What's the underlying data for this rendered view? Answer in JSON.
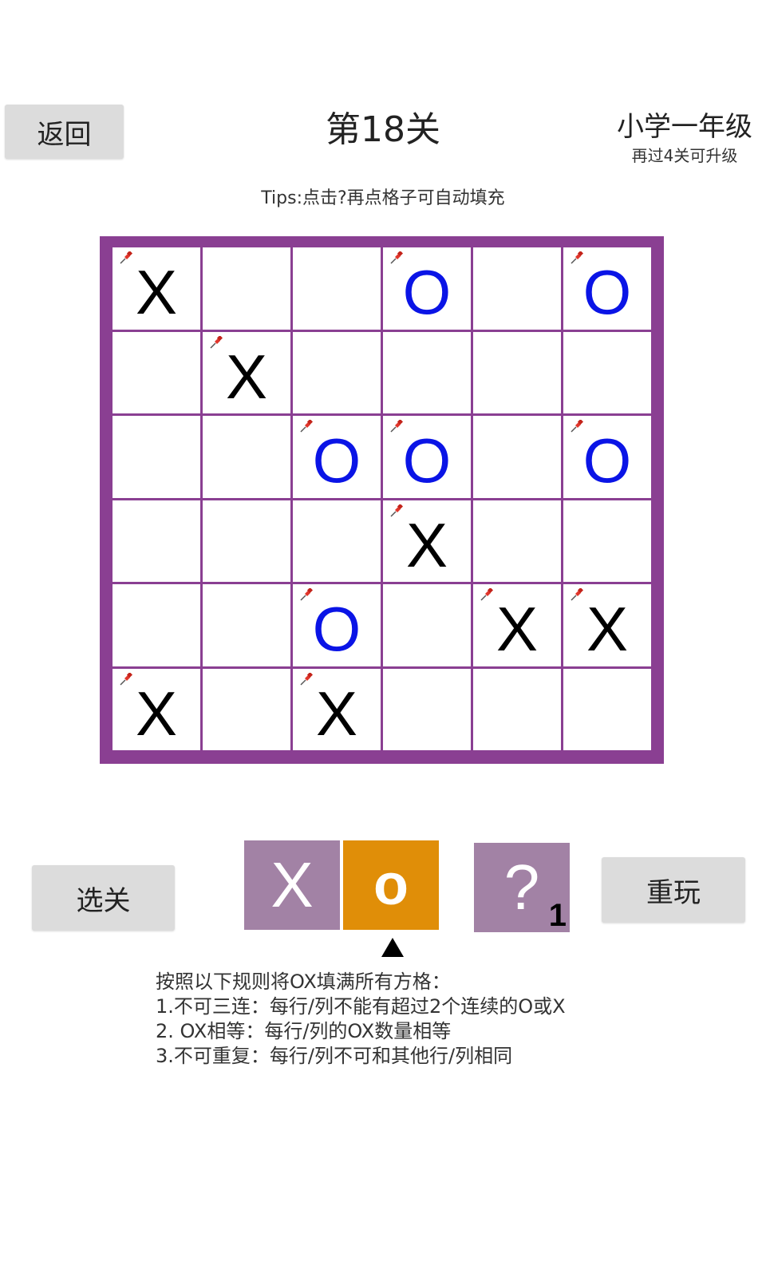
{
  "header": {
    "back_label": "返回",
    "level_title": "第18关",
    "grade": "小学一年级",
    "grade_progress": "再过4关可升级"
  },
  "tips": "Tips:点击?再点格子可自动填充",
  "board": {
    "rows": 6,
    "cols": 6,
    "cells": [
      [
        {
          "v": "X",
          "fixed": true
        },
        {
          "v": "",
          "fixed": false
        },
        {
          "v": "",
          "fixed": false
        },
        {
          "v": "O",
          "fixed": true
        },
        {
          "v": "",
          "fixed": false
        },
        {
          "v": "O",
          "fixed": true
        }
      ],
      [
        {
          "v": "",
          "fixed": false
        },
        {
          "v": "X",
          "fixed": true
        },
        {
          "v": "",
          "fixed": false
        },
        {
          "v": "",
          "fixed": false
        },
        {
          "v": "",
          "fixed": false
        },
        {
          "v": "",
          "fixed": false
        }
      ],
      [
        {
          "v": "",
          "fixed": false
        },
        {
          "v": "",
          "fixed": false
        },
        {
          "v": "O",
          "fixed": true
        },
        {
          "v": "O",
          "fixed": true
        },
        {
          "v": "",
          "fixed": false
        },
        {
          "v": "O",
          "fixed": true
        }
      ],
      [
        {
          "v": "",
          "fixed": false
        },
        {
          "v": "",
          "fixed": false
        },
        {
          "v": "",
          "fixed": false
        },
        {
          "v": "X",
          "fixed": true
        },
        {
          "v": "",
          "fixed": false
        },
        {
          "v": "",
          "fixed": false
        }
      ],
      [
        {
          "v": "",
          "fixed": false
        },
        {
          "v": "",
          "fixed": false
        },
        {
          "v": "O",
          "fixed": true
        },
        {
          "v": "",
          "fixed": false
        },
        {
          "v": "X",
          "fixed": true
        },
        {
          "v": "X",
          "fixed": true
        }
      ],
      [
        {
          "v": "X",
          "fixed": true
        },
        {
          "v": "",
          "fixed": false
        },
        {
          "v": "X",
          "fixed": true
        },
        {
          "v": "",
          "fixed": false
        },
        {
          "v": "",
          "fixed": false
        },
        {
          "v": "",
          "fixed": false
        }
      ]
    ]
  },
  "controls": {
    "select_level_label": "选关",
    "replay_label": "重玩",
    "tool_x_label": "X",
    "tool_o_label": "o",
    "tool_hint_label": "?",
    "hint_count": "1",
    "selected_tool": "o"
  },
  "rules": [
    "按照以下规则将OX填满所有方格：",
    "1.不可三连：每行/列不能有超过2个连续的O或X",
    "2. OX相等：每行/列的OX数量相等",
    "3.不可重复：每行/列不可和其他行/列相同"
  ],
  "colors": {
    "board_border": "#8a3f92",
    "x_mark": "#000000",
    "o_mark": "#0a14e6",
    "tool_inactive": "#a282a5",
    "tool_active": "#e08e08"
  }
}
